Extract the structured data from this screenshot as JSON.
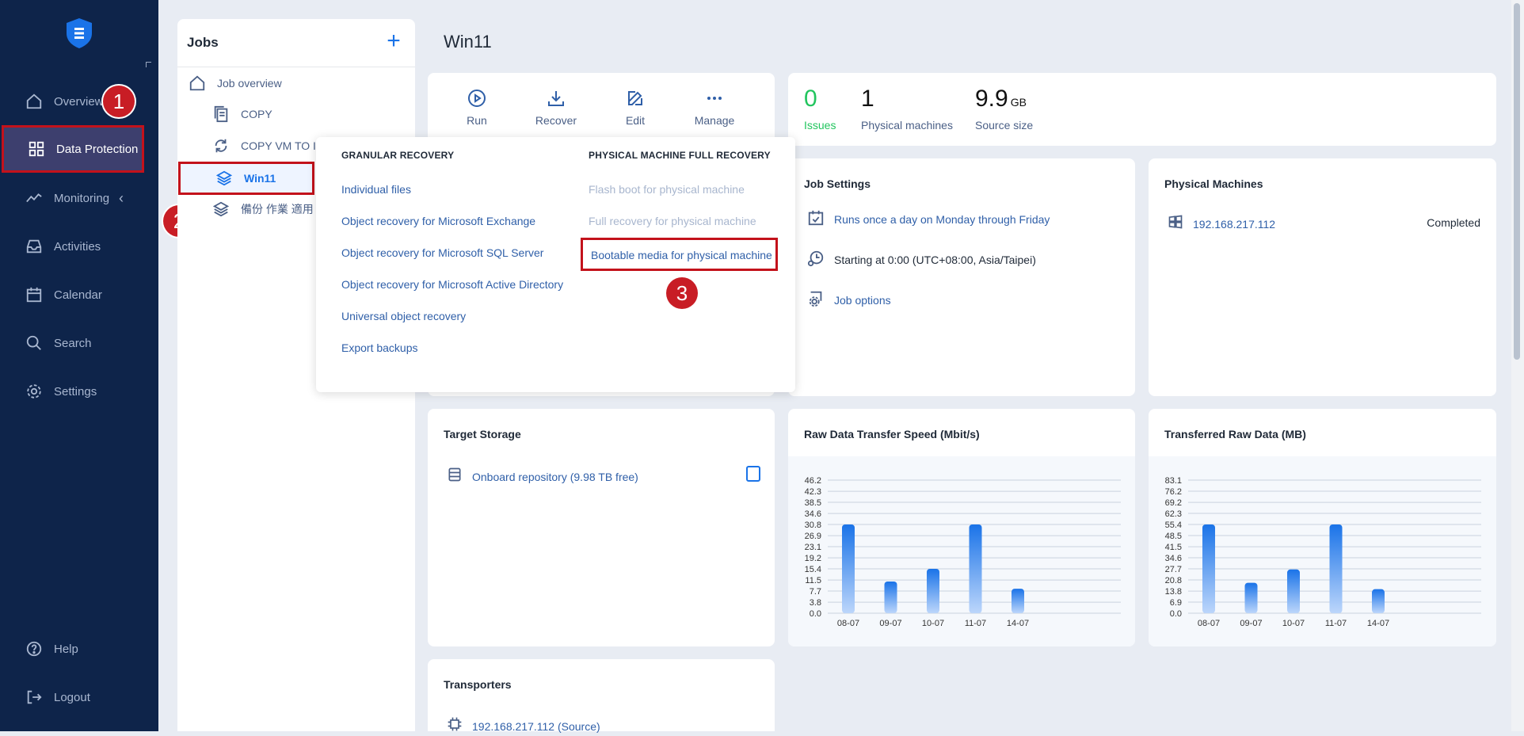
{
  "sidebar": {
    "items": [
      {
        "label": "Overview",
        "icon": "home-icon"
      },
      {
        "label": "Data Protection",
        "icon": "grid-icon"
      },
      {
        "label": "Monitoring",
        "icon": "activity-chart-icon"
      },
      {
        "label": "Activities",
        "icon": "inbox-icon"
      },
      {
        "label": "Calendar",
        "icon": "calendar-icon"
      },
      {
        "label": "Search",
        "icon": "search-icon"
      },
      {
        "label": "Settings",
        "icon": "gear-icon"
      }
    ],
    "bottom": [
      {
        "label": "Help",
        "icon": "help-icon"
      },
      {
        "label": "Logout",
        "icon": "logout-icon"
      }
    ]
  },
  "badges": [
    "1",
    "2",
    "3"
  ],
  "jobs": {
    "title": "Jobs",
    "overview_label": "Job overview",
    "items": [
      {
        "label": "COPY"
      },
      {
        "label": "COPY VM TO I"
      },
      {
        "label": "Win11"
      },
      {
        "label": "備份 作業 適用"
      }
    ]
  },
  "main": {
    "title": "Win11",
    "toolbar": {
      "run": "Run",
      "recover": "Recover",
      "edit": "Edit",
      "manage": "Manage"
    },
    "stats": {
      "issues_value": "0",
      "issues_label": "Issues",
      "machines_value": "1",
      "machines_label": "Physical machines",
      "size_value": "9.9",
      "size_unit": "GB",
      "size_label": "Source size"
    },
    "job_settings": {
      "title": "Job Settings",
      "schedule": "Runs once a day on Monday through Friday",
      "start": "Starting at 0:00 (UTC+08:00, Asia/Taipei)",
      "options": "Job options"
    },
    "physical_machines": {
      "title": "Physical Machines",
      "ip": "192.168.217.112",
      "status": "Completed"
    },
    "target_storage": {
      "title": "Target Storage",
      "repo": "Onboard repository (9.98 TB free)"
    },
    "transporters": {
      "title": "Transporters",
      "item": "192.168.217.112 (Source)"
    }
  },
  "recover_menu": {
    "granular_title": "GRANULAR RECOVERY",
    "granular_items": [
      "Individual files",
      "Object recovery for Microsoft Exchange",
      "Object recovery for Microsoft SQL Server",
      "Object recovery for Microsoft Active Directory",
      "Universal object recovery",
      "Export backups"
    ],
    "full_title": "PHYSICAL MACHINE FULL RECOVERY",
    "full_items": [
      {
        "label": "Flash boot for physical machine",
        "enabled": false
      },
      {
        "label": "Full recovery for physical machine",
        "enabled": false
      },
      {
        "label": "Bootable media for physical machine",
        "enabled": true
      }
    ]
  },
  "colors": {
    "sidebar": "#0e244a",
    "accent": "#1a73e8",
    "highlight": "#c3121b",
    "issues": "#22c55e"
  },
  "chart_data": [
    {
      "type": "bar",
      "title": "Raw Data Transfer Speed (Mbit/s)",
      "categories": [
        "08-07",
        "09-07",
        "10-07",
        "11-07",
        "14-07"
      ],
      "values": [
        30.8,
        11.0,
        15.4,
        30.8,
        8.5
      ],
      "yticks": [
        "0.0",
        "3.8",
        "7.7",
        "11.5",
        "15.4",
        "19.2",
        "23.1",
        "26.9",
        "30.8",
        "34.6",
        "38.5",
        "42.3",
        "46.2"
      ],
      "ylim": [
        0,
        46.2
      ],
      "grid": true
    },
    {
      "type": "bar",
      "title": "Transferred Raw Data (MB)",
      "categories": [
        "08-07",
        "09-07",
        "10-07",
        "11-07",
        "14-07"
      ],
      "values": [
        55.4,
        19.0,
        27.3,
        55.4,
        15.0
      ],
      "yticks": [
        "0.0",
        "6.9",
        "13.8",
        "20.8",
        "27.7",
        "34.6",
        "41.5",
        "48.5",
        "55.4",
        "62.3",
        "69.2",
        "76.2",
        "83.1"
      ],
      "ylim": [
        0,
        83.1
      ],
      "grid": true
    }
  ]
}
